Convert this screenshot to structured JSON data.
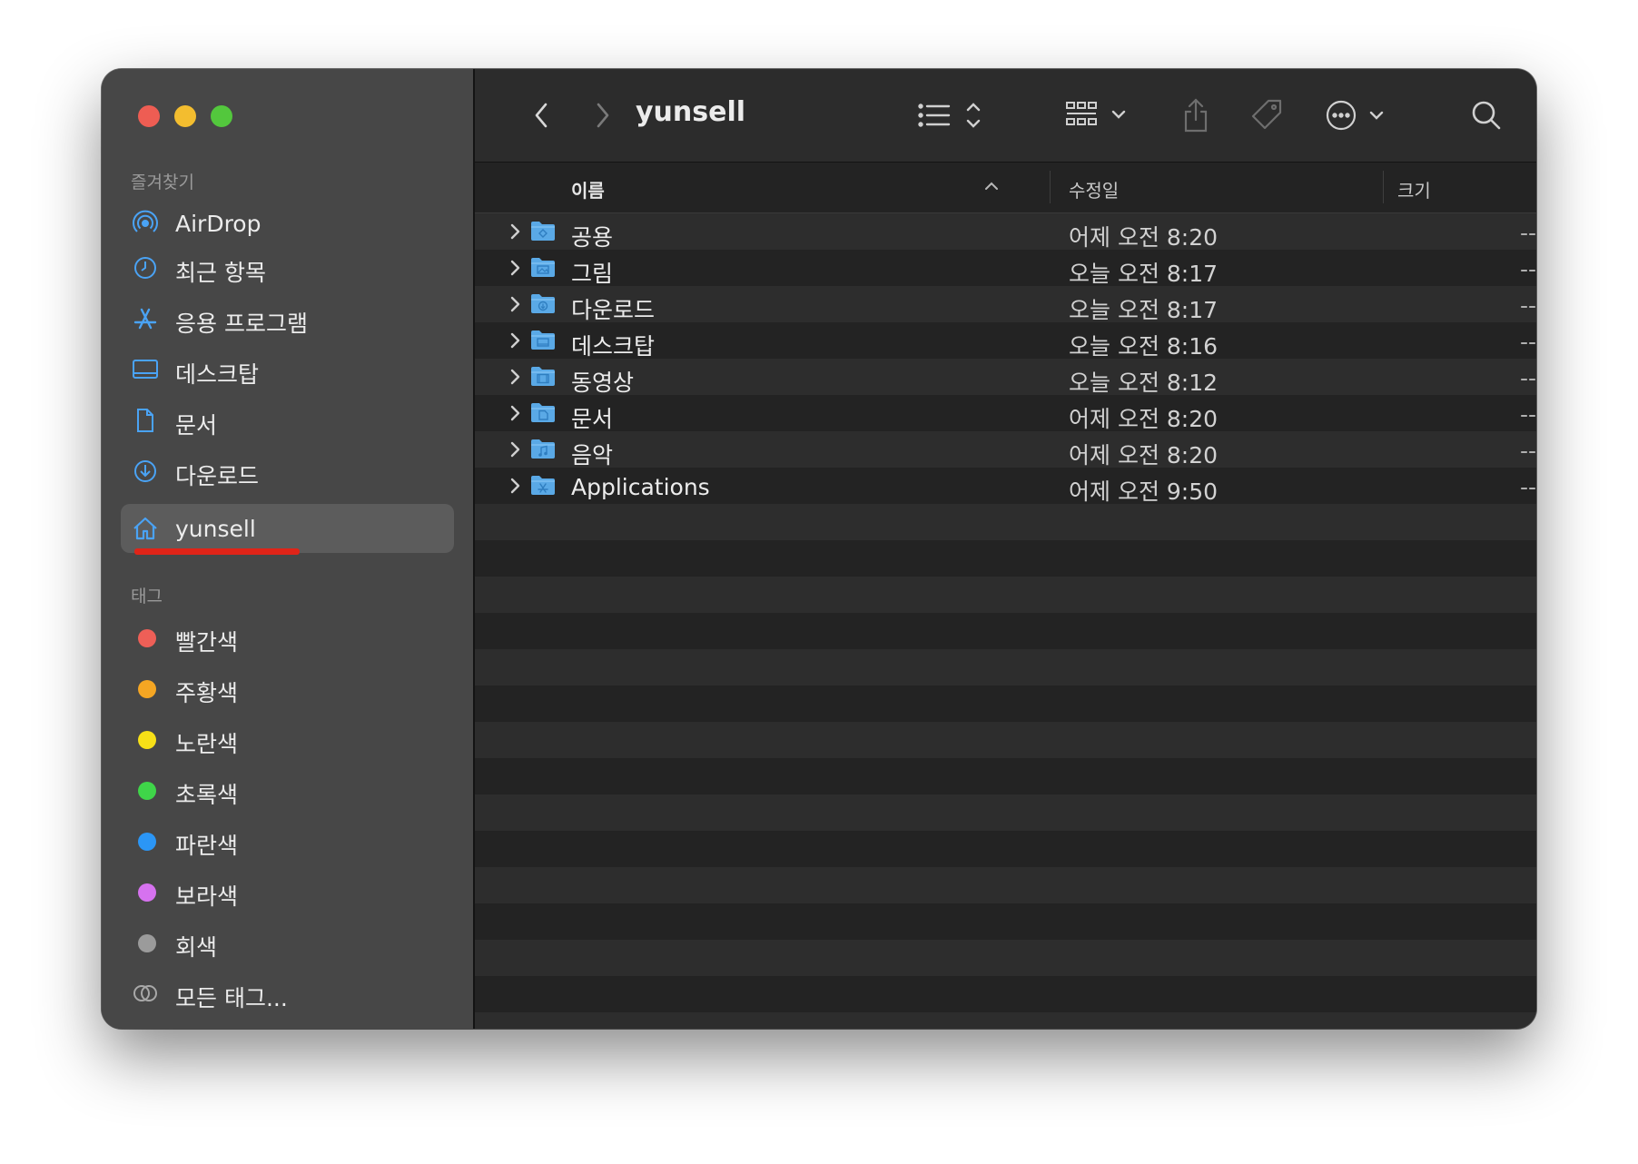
{
  "window": {
    "title": "yunsell"
  },
  "sidebar": {
    "favorites_header": "즐겨찾기",
    "favorites": [
      {
        "label": "AirDrop",
        "icon": "airdrop-icon"
      },
      {
        "label": "최근 항목",
        "icon": "clock-icon"
      },
      {
        "label": "응용 프로그램",
        "icon": "applications-icon"
      },
      {
        "label": "데스크탑",
        "icon": "desktop-icon"
      },
      {
        "label": "문서",
        "icon": "document-icon"
      },
      {
        "label": "다운로드",
        "icon": "download-icon"
      },
      {
        "label": "yunsell",
        "icon": "home-icon",
        "selected": true
      }
    ],
    "tags_header": "태그",
    "tags": [
      {
        "label": "빨간색",
        "color": "#ee5f57"
      },
      {
        "label": "주황색",
        "color": "#f5a623"
      },
      {
        "label": "노란색",
        "color": "#f7e017"
      },
      {
        "label": "초록색",
        "color": "#3fd549"
      },
      {
        "label": "파란색",
        "color": "#2b96f6"
      },
      {
        "label": "보라색",
        "color": "#d672ef"
      },
      {
        "label": "회색",
        "color": "#9b9b9b"
      },
      {
        "label": "모든 태그...",
        "icon": "all-tags-icon"
      }
    ]
  },
  "columns": {
    "name": "이름",
    "modified": "수정일",
    "size": "크기"
  },
  "files": [
    {
      "name": "공용",
      "modified": "어제 오전 8:20",
      "size": "--",
      "glyph": "public"
    },
    {
      "name": "그림",
      "modified": "오늘 오전 8:17",
      "size": "--",
      "glyph": "pictures"
    },
    {
      "name": "다운로드",
      "modified": "오늘 오전 8:17",
      "size": "--",
      "glyph": "downloads"
    },
    {
      "name": "데스크탑",
      "modified": "오늘 오전 8:16",
      "size": "--",
      "glyph": "desktop"
    },
    {
      "name": "동영상",
      "modified": "오늘 오전 8:12",
      "size": "--",
      "glyph": "movies"
    },
    {
      "name": "문서",
      "modified": "어제 오전 8:20",
      "size": "--",
      "glyph": "documents"
    },
    {
      "name": "음악",
      "modified": "어제 오전 8:20",
      "size": "--",
      "glyph": "music"
    },
    {
      "name": "Applications",
      "modified": "어제 오전 9:50",
      "size": "--",
      "glyph": "applications"
    }
  ],
  "colors": {
    "accent_folder": "#5aa9e6",
    "sidebar_icon": "#4aa3f5",
    "selection_underline": "#e02418"
  }
}
